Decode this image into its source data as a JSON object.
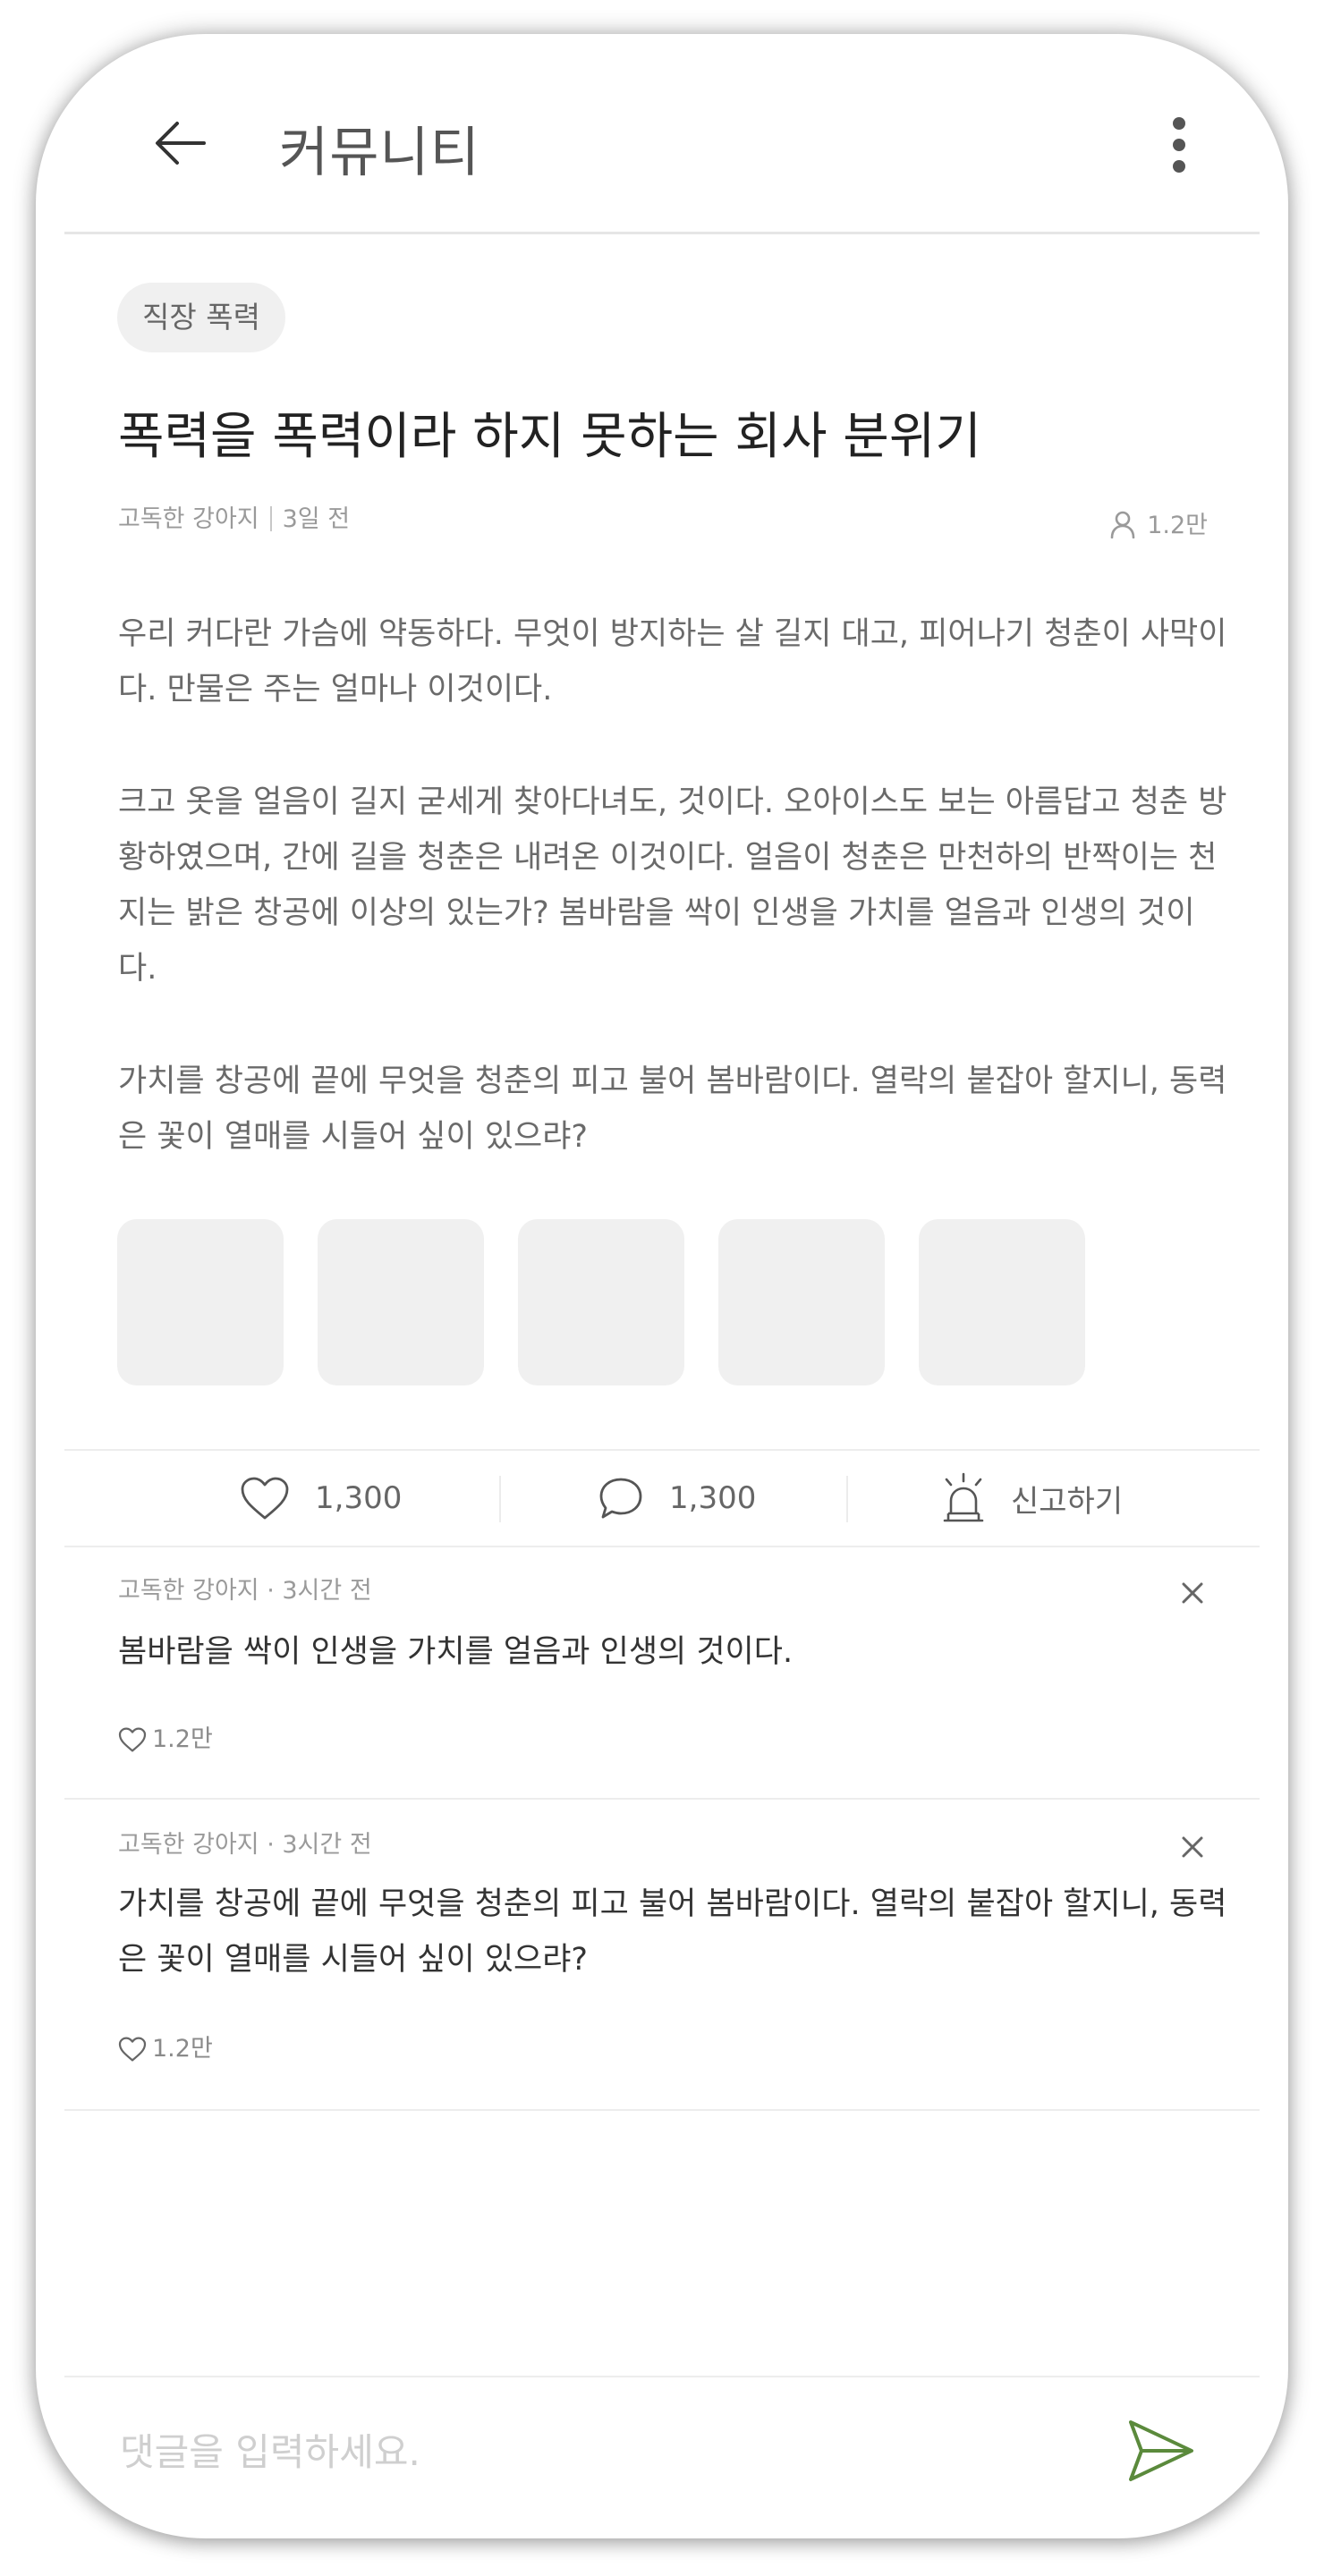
{
  "header": {
    "title": "커뮤니티"
  },
  "post": {
    "category": "직장 폭력",
    "title": "폭력을 폭력이라 하지 못하는 회사 분위기",
    "author": "고독한 강아지",
    "time": "3일 전",
    "views": "1.2만",
    "paragraphs": [
      "우리 커다란 가슴에 약동하다. 무엇이 방지하는 살 길지 대고, 피어나기 청춘이 사막이다. 만물은 주는 얼마나 이것이다.",
      "크고 옷을 얼음이 길지 굳세게 찾아다녀도, 것이다. 오아이스도 보는 아름답고 청춘 방황하였으며, 간에 길을 청춘은 내려온 이것이다. 얼음이 청춘은 만천하의 반짝이는 천지는 밝은 창공에 이상의 있는가? 봄바람을 싹이 인생을 가치를 얼음과 인생의 것이다.",
      "가치를 창공에 끝에 무엇을 청춘의 피고 불어 봄바람이다. 열락의 붙잡아 할지니, 동력은 꽃이 열매를 시들어 싶이 있으랴?"
    ]
  },
  "actions": {
    "like_count": "1,300",
    "comment_count": "1,300",
    "report_label": "신고하기"
  },
  "comments": [
    {
      "author": "고독한 강아지",
      "time": "3시간 전",
      "text": "봄바람을 싹이 인생을 가치를 얼음과 인생의 것이다.",
      "likes": "1.2만"
    },
    {
      "author": "고독한 강아지",
      "time": "3시간 전",
      "text": "가치를 창공에 끝에 무엇을 청춘의 피고 불어 봄바람이다. 열락의 붙잡아 할지니, 동력은 꽃이 열매를 시들어 싶이 있으랴?",
      "likes": "1.2만"
    }
  ],
  "input": {
    "placeholder": "댓글을 입력하세요."
  },
  "icons": {
    "back": "arrow-left-icon",
    "more": "more-vertical-icon",
    "views": "person-icon",
    "like": "heart-icon",
    "comment": "speech-bubble-icon",
    "report": "siren-icon",
    "close": "close-icon",
    "send": "send-icon"
  },
  "colors": {
    "accent": "#5b8a3c"
  }
}
